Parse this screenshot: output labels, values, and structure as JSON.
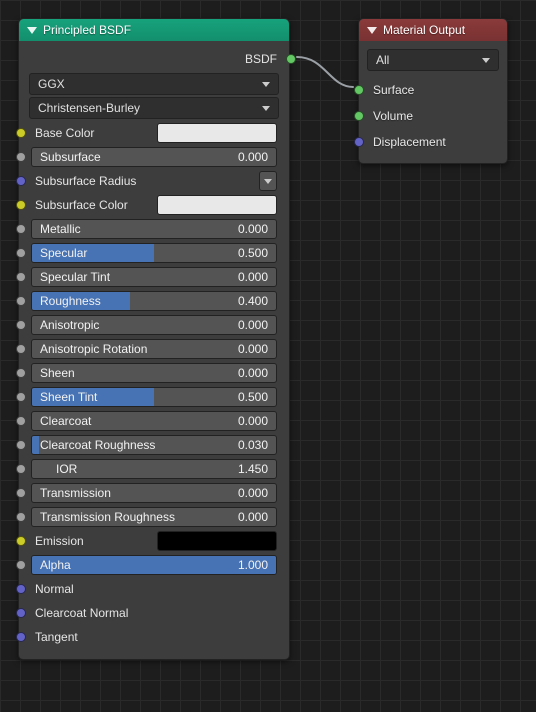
{
  "bsdf": {
    "title": "Principled BSDF",
    "output_label": "BSDF",
    "distribution": "GGX",
    "subsurface_method": "Christensen-Burley",
    "props": {
      "base_color": {
        "label": "Base Color",
        "swatch": "#e8e8e8"
      },
      "subsurface": {
        "label": "Subsurface",
        "value": "0.000",
        "fill": 0.0
      },
      "subsurface_radius": {
        "label": "Subsurface Radius"
      },
      "subsurface_color": {
        "label": "Subsurface Color",
        "swatch": "#e8e8e8"
      },
      "metallic": {
        "label": "Metallic",
        "value": "0.000",
        "fill": 0.0
      },
      "specular": {
        "label": "Specular",
        "value": "0.500",
        "fill": 0.5
      },
      "specular_tint": {
        "label": "Specular Tint",
        "value": "0.000",
        "fill": 0.0
      },
      "roughness": {
        "label": "Roughness",
        "value": "0.400",
        "fill": 0.4
      },
      "anisotropic": {
        "label": "Anisotropic",
        "value": "0.000",
        "fill": 0.0
      },
      "aniso_rotation": {
        "label": "Anisotropic Rotation",
        "value": "0.000",
        "fill": 0.0
      },
      "sheen": {
        "label": "Sheen",
        "value": "0.000",
        "fill": 0.0
      },
      "sheen_tint": {
        "label": "Sheen Tint",
        "value": "0.500",
        "fill": 0.5
      },
      "clearcoat": {
        "label": "Clearcoat",
        "value": "0.000",
        "fill": 0.0
      },
      "clearcoat_rough": {
        "label": "Clearcoat Roughness",
        "value": "0.030",
        "fill": 0.03
      },
      "ior": {
        "label": "IOR",
        "value": "1.450"
      },
      "transmission": {
        "label": "Transmission",
        "value": "0.000",
        "fill": 0.0
      },
      "trans_roughness": {
        "label": "Transmission Roughness",
        "value": "0.000",
        "fill": 0.0
      },
      "emission": {
        "label": "Emission",
        "swatch": "#000000"
      },
      "alpha": {
        "label": "Alpha",
        "value": "1.000",
        "fill": 1.0
      },
      "normal": {
        "label": "Normal"
      },
      "clearcoat_normal": {
        "label": "Clearcoat Normal"
      },
      "tangent": {
        "label": "Tangent"
      }
    }
  },
  "material_output": {
    "title": "Material Output",
    "target": "All",
    "inputs": {
      "surface": "Surface",
      "volume": "Volume",
      "displacement": "Displacement"
    }
  }
}
